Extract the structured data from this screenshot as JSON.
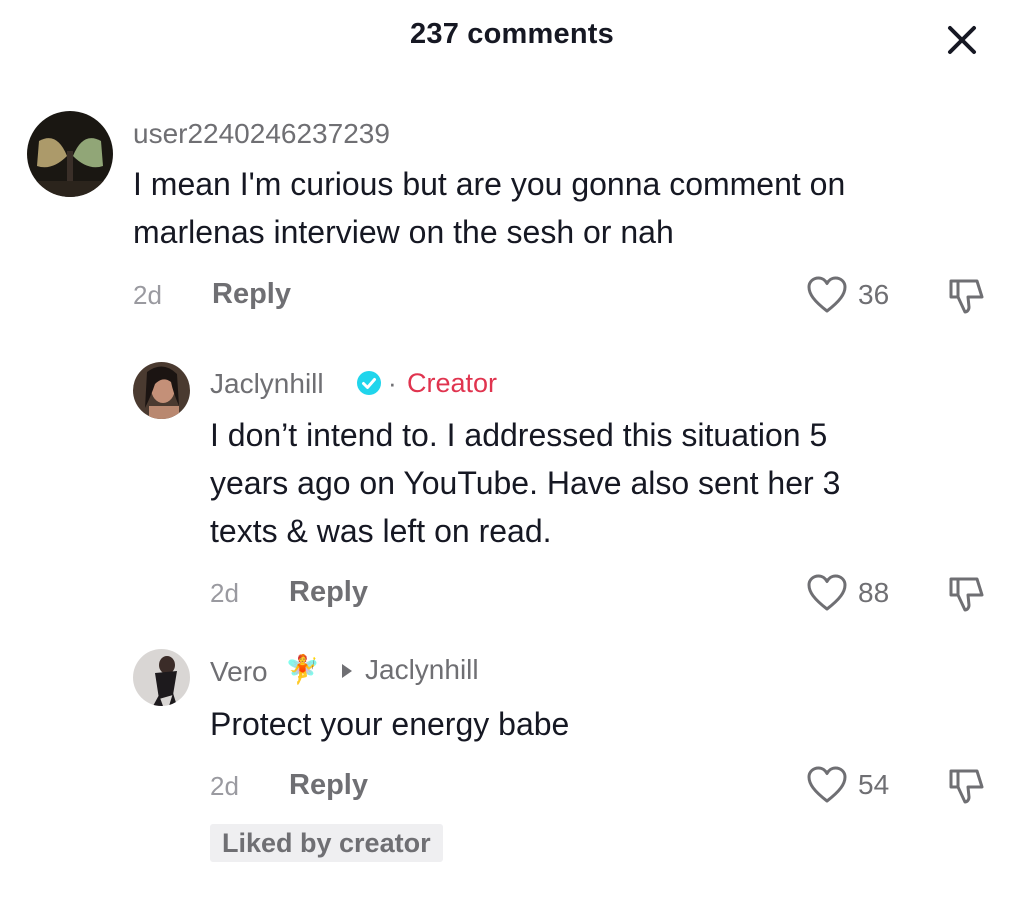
{
  "header": {
    "title": "237 comments",
    "close_icon": "close-icon"
  },
  "colors": {
    "creator": "#e0344f",
    "verified": "#20d5ec",
    "text": "#161823",
    "muted": "#6f6f73"
  },
  "comments": [
    {
      "username": "user2240246237239",
      "text_lines": [
        "I mean I'm curious but are you gonna comment on",
        "marlenas interview on the sesh or nah"
      ],
      "date": "2d",
      "reply_label": "Reply",
      "likes": "36"
    }
  ],
  "replies": [
    {
      "username": "Jaclynhill",
      "verified_icon": "verified-badge-icon",
      "separator": "·",
      "badge": "Creator",
      "text_lines": [
        "I don’t intend to. I addressed this situation 5",
        "years ago on YouTube. Have also sent her 3",
        "texts & was left on read."
      ],
      "date": "2d",
      "reply_label": "Reply",
      "likes": "88"
    },
    {
      "username": "Vero",
      "emoji": "🧚",
      "reply_to_icon": "caret-right-icon",
      "reply_to": "Jaclynhill",
      "text_lines": [
        "Protect your energy babe"
      ],
      "date": "2d",
      "reply_label": "Reply",
      "likes": "54",
      "liked_by": "Liked by creator"
    }
  ]
}
